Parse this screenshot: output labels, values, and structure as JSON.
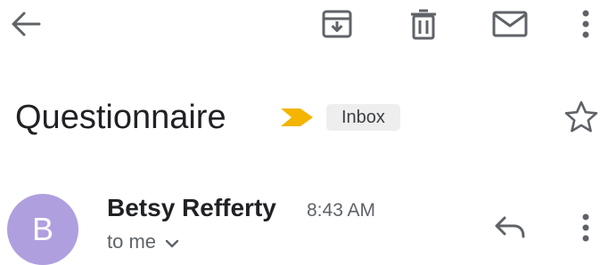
{
  "toolbar": {
    "icons": [
      "back-arrow-icon",
      "archive-icon",
      "delete-icon",
      "mail-icon",
      "more-vert-icon"
    ]
  },
  "email": {
    "subject": "Questionnaire",
    "label": "Inbox",
    "importance_color": "#f4b400",
    "starred": false
  },
  "sender": {
    "initial": "B",
    "avatar_color": "#b09fdf",
    "name": "Betsy Refferty",
    "time": "8:43 AM",
    "recipient": "to me"
  }
}
